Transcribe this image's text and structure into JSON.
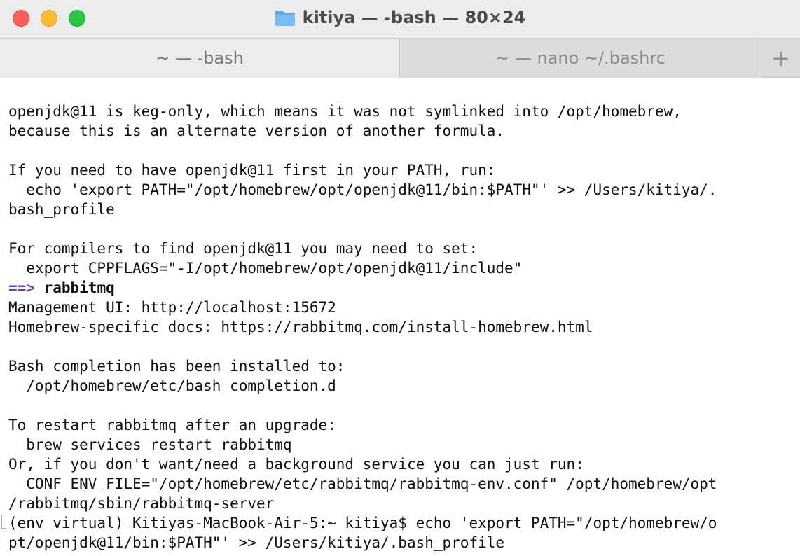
{
  "window": {
    "title": "kitiya — -bash — 80×24"
  },
  "tabs": [
    {
      "label": "~ — -bash"
    },
    {
      "label": "~ — nano ~/.bashrc"
    }
  ],
  "new_tab_label": "+",
  "terminal": {
    "lines": [
      "openjdk@11 is keg-only, which means it was not symlinked into /opt/homebrew,",
      "because this is an alternate version of another formula.",
      "",
      "If you need to have openjdk@11 first in your PATH, run:",
      "  echo 'export PATH=\"/opt/homebrew/opt/openjdk@11/bin:$PATH\"' >> /Users/kitiya/.",
      "bash_profile",
      "",
      "For compilers to find openjdk@11 you may need to set:",
      "  export CPPFLAGS=\"-I/opt/homebrew/opt/openjdk@11/include\"",
      "",
      "Management UI: http://localhost:15672",
      "Homebrew-specific docs: https://rabbitmq.com/install-homebrew.html",
      "",
      "Bash completion has been installed to:",
      "  /opt/homebrew/etc/bash_completion.d",
      "",
      "To restart rabbitmq after an upgrade:",
      "  brew services restart rabbitmq",
      "Or, if you don't want/need a background service you can just run:",
      "  CONF_ENV_FILE=\"/opt/homebrew/etc/rabbitmq/rabbitmq-env.conf\" /opt/homebrew/opt",
      "/rabbitmq/sbin/rabbitmq-server",
      "(env_virtual) Kitiyas-MacBook-Air-5:~ kitiya$ echo 'export PATH=\"/opt/homebrew/o",
      "pt/openjdk@11/bin:$PATH\"' >> /Users/kitiya/.bash_profile"
    ],
    "section_arrow": "==>",
    "section_name": "rabbitmq"
  },
  "colors": {
    "arrow": "#5b3fd6",
    "close": "#ff5f57",
    "minimize": "#febc2e",
    "zoom": "#28c840"
  },
  "icons": [
    "folder-icon",
    "plus-icon"
  ]
}
